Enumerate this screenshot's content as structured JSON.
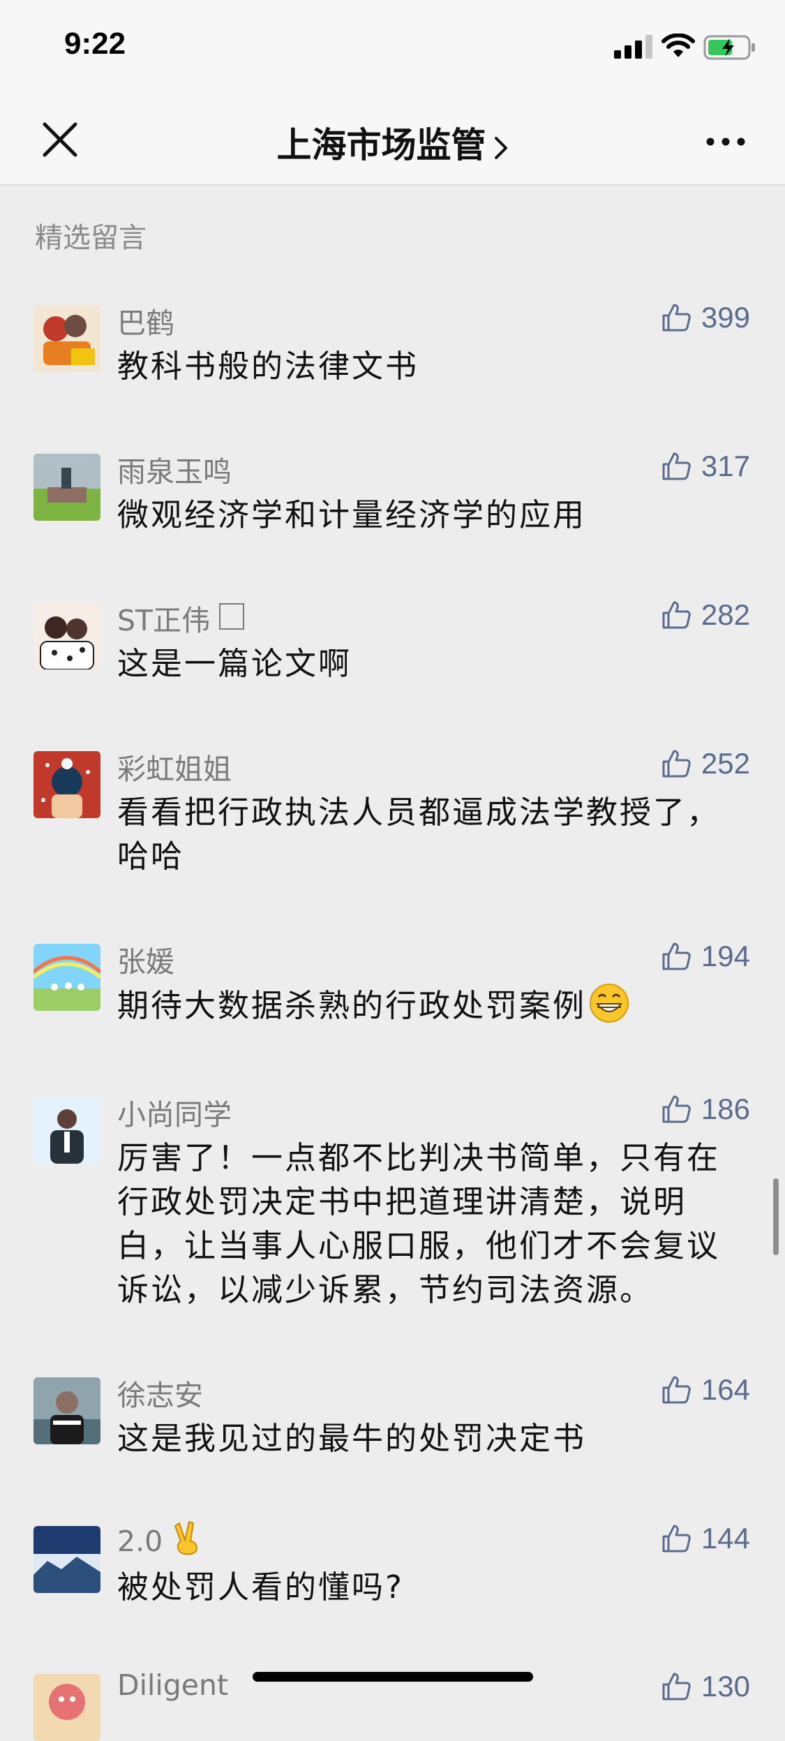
{
  "status_bar": {
    "time": "9:22"
  },
  "nav": {
    "title": "上海市场监管"
  },
  "section": {
    "title": "精选留言"
  },
  "comments": [
    {
      "name": "巴鹤",
      "text": "教科书般的法律文书",
      "likes": "399"
    },
    {
      "name": "雨泉玉鸣",
      "text": "微观经济学和计量经济学的应用",
      "likes": "317"
    },
    {
      "name": "ST正伟",
      "text": "这是一篇论文啊",
      "likes": "282"
    },
    {
      "name": "彩虹姐姐",
      "text": "看看把行政执法人员都逼成法学教授了，哈哈",
      "likes": "252"
    },
    {
      "name": "张媛",
      "text": "期待大数据杀熟的行政处罚案例",
      "likes": "194"
    },
    {
      "name": "小尚同学",
      "text": "厉害了！一点都不比判决书简单，只有在行政处罚决定书中把道理讲清楚，说明白，让当事人心服口服，他们才不会复议诉讼，以减少诉累，节约司法资源。",
      "likes": "186"
    },
    {
      "name": "徐志安",
      "text": "这是我见过的最牛的处罚决定书",
      "likes": "164"
    },
    {
      "name": "2.0",
      "text": "被处罚人看的懂吗?",
      "likes": "144"
    },
    {
      "name": "Diligent",
      "text": "",
      "likes": "130"
    }
  ]
}
